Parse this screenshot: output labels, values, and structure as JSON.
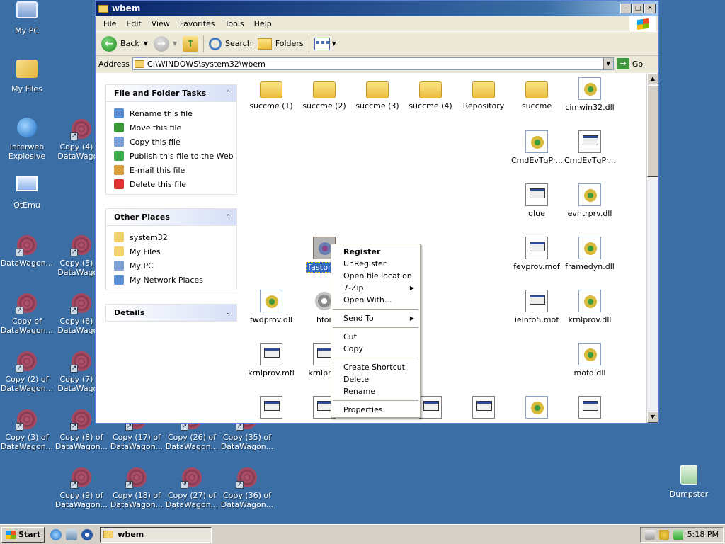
{
  "desktop": {
    "icons": [
      {
        "label": "My PC",
        "type": "mypc"
      },
      {
        "label": "My Files",
        "type": "myfiles"
      },
      {
        "label": "Interweb Explosive",
        "type": "ie"
      },
      {
        "label": "Copy (4) of DataWago...",
        "type": "dw"
      },
      {
        "label": "QtEmu",
        "type": "qemu"
      },
      {
        "label": "DataWagon...",
        "type": "dw"
      },
      {
        "label": "Copy (5) of DataWago...",
        "type": "dw"
      },
      {
        "label": "Copy of DataWagon...",
        "type": "dw"
      },
      {
        "label": "Copy (6) of DataWago...",
        "type": "dw"
      },
      {
        "label": "Copy (2) of DataWagon...",
        "type": "dw"
      },
      {
        "label": "Copy (7) of DataWago...",
        "type": "dw"
      },
      {
        "label": "Copy (3) of DataWagon...",
        "type": "dw"
      },
      {
        "label": "Copy (8) of DataWagon...",
        "type": "dw"
      },
      {
        "label": "Copy (17) of DataWagon...",
        "type": "dw"
      },
      {
        "label": "Copy (26) of DataWagon...",
        "type": "dw"
      },
      {
        "label": "Copy (35) of DataWagon...",
        "type": "dw"
      },
      {
        "label": "Copy (9) of DataWagon...",
        "type": "dw"
      },
      {
        "label": "Copy (18) of DataWagon...",
        "type": "dw"
      },
      {
        "label": "Copy (27) of DataWagon...",
        "type": "dw"
      },
      {
        "label": "Copy (36) of DataWagon...",
        "type": "dw"
      },
      {
        "label": "Dumpster",
        "type": "bin"
      }
    ]
  },
  "window": {
    "title": "wbem",
    "menu": [
      "File",
      "Edit",
      "View",
      "Favorites",
      "Tools",
      "Help"
    ],
    "toolbar": {
      "back": "Back",
      "search": "Search",
      "folders": "Folders"
    },
    "address": {
      "label": "Address",
      "value": "C:\\WINDOWS\\system32\\wbem",
      "go": "Go"
    }
  },
  "tasks": {
    "file_tasks": {
      "title": "File and Folder Tasks",
      "items": [
        "Rename this file",
        "Move this file",
        "Copy this file",
        "Publish this file to the Web",
        "E-mail this file",
        "Delete this file"
      ]
    },
    "other_places": {
      "title": "Other Places",
      "items": [
        "system32",
        "My Files",
        "My PC",
        "My Network Places"
      ]
    },
    "details": {
      "title": "Details"
    }
  },
  "files": [
    {
      "name": "succme (1)",
      "type": "folder"
    },
    {
      "name": "succme (2)",
      "type": "folder"
    },
    {
      "name": "succme (3)",
      "type": "folder"
    },
    {
      "name": "succme (4)",
      "type": "folder"
    },
    {
      "name": "Repository",
      "type": "folder"
    },
    {
      "name": "succme",
      "type": "folder"
    },
    {
      "name": "cimwin32.dll",
      "type": "dll"
    },
    {
      "name": "CmdEvTgPr...",
      "type": "dll"
    },
    {
      "name": "CmdEvTgPr...",
      "type": "mof"
    },
    {
      "name": "glue",
      "type": "mof"
    },
    {
      "name": "evntrprv.dll",
      "type": "dll"
    },
    {
      "name": "fastprov",
      "type": "dll",
      "selected": true
    },
    {
      "name": "fevprov.mof",
      "type": "mof"
    },
    {
      "name": "framedyn.dll",
      "type": "dll"
    },
    {
      "name": "fwdprov.dll",
      "type": "dll"
    },
    {
      "name": "hfor",
      "type": "gear"
    },
    {
      "name": "ieinfo5.mof",
      "type": "mof"
    },
    {
      "name": "krnlprov.dll",
      "type": "dll"
    },
    {
      "name": "krnlprov.mfl",
      "type": "mof"
    },
    {
      "name": "krnlprov",
      "type": "mof"
    },
    {
      "name": "mofd.dll",
      "type": "dll"
    }
  ],
  "context_menu": {
    "items": [
      {
        "label": "Register",
        "bold": true
      },
      {
        "label": "UnRegister"
      },
      {
        "label": "Open file location"
      },
      {
        "label": "7-Zip",
        "submenu": true
      },
      {
        "label": "Open With..."
      },
      {
        "sep": true
      },
      {
        "label": "Send To",
        "submenu": true
      },
      {
        "sep": true
      },
      {
        "label": "Cut"
      },
      {
        "label": "Copy"
      },
      {
        "sep": true
      },
      {
        "label": "Create Shortcut"
      },
      {
        "label": "Delete"
      },
      {
        "label": "Rename"
      },
      {
        "sep": true
      },
      {
        "label": "Properties"
      }
    ]
  },
  "taskbar": {
    "start": "Start",
    "task": "wbem",
    "clock": "5:18 PM"
  }
}
